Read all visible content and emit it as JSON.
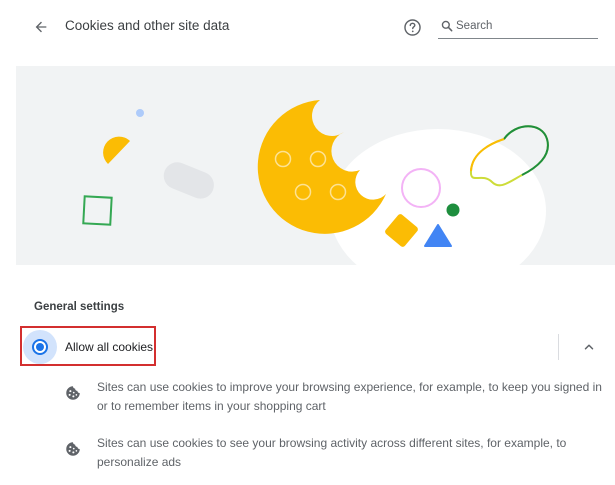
{
  "header": {
    "title": "Cookies and other site data",
    "back_icon": "arrow-back-icon",
    "help_icon": "help-circle-icon",
    "search": {
      "placeholder": "Search",
      "value": "",
      "icon": "search-icon"
    }
  },
  "general": {
    "section_title": "General settings",
    "option": {
      "label": "Allow all cookies",
      "selected": true,
      "expand_icon": "chevron-up-icon"
    },
    "descriptions": [
      {
        "icon": "cookie-icon",
        "text": "Sites can use cookies to improve your browsing experience, for example, to keep you signed in or to remember items in your shopping cart"
      },
      {
        "icon": "cookie-icon",
        "text": "Sites can use cookies to see your browsing activity across different sites, for example, to personalize ads"
      }
    ]
  },
  "colors": {
    "accent": "#1a73e8",
    "cookie": "#fbbc04",
    "highlight": "#d32f2f",
    "banner_bg": "#f1f3f4"
  }
}
